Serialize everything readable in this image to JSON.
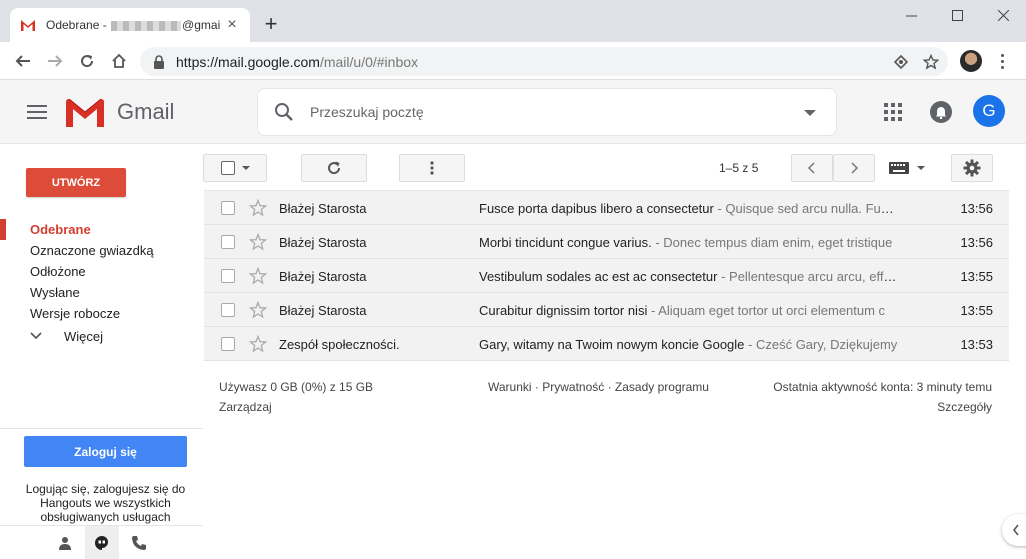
{
  "browser": {
    "tab_title_prefix": "Odebrane - ",
    "tab_title_suffix": "@gmai",
    "url_host": "https://mail.google.com",
    "url_path": "/mail/u/0/#inbox"
  },
  "gmail": {
    "brand": "Gmail",
    "search_placeholder": "Przeszukaj pocztę",
    "avatar_letter": "G",
    "accent": "#dd4b39",
    "blue": "#4285f4"
  },
  "sidebar": {
    "compose_label": "UTWÓRZ",
    "items": [
      {
        "label": "Odebrane",
        "active": true
      },
      {
        "label": "Oznaczone gwiazdką"
      },
      {
        "label": "Odłożone"
      },
      {
        "label": "Wysłane"
      },
      {
        "label": "Wersje robocze"
      }
    ],
    "more_label": "Więcej",
    "login_label": "Zaloguj się",
    "hangouts_text": "Logując się, zalogujesz się do Hangouts we wszystkich obsługiwanych usługach"
  },
  "toolbar": {
    "pager_text": "1–5 z 5"
  },
  "mails": [
    {
      "sender": "Błażej Starosta",
      "subject": "Fusce porta dapibus libero a consectetur",
      "snippet": " - Quisque sed arcu nulla. Fusce",
      "time": "13:56"
    },
    {
      "sender": "Błażej Starosta",
      "subject": "Morbi tincidunt congue varius.",
      "snippet": " - Donec tempus diam enim, eget tristique",
      "time": "13:56"
    },
    {
      "sender": "Błażej Starosta",
      "subject": "Vestibulum sodales ac est ac consectetur",
      "snippet": " - Pellentesque arcu arcu, efficitur",
      "time": "13:55"
    },
    {
      "sender": "Błażej Starosta",
      "subject": "Curabitur dignissim tortor nisi",
      "snippet": " - Aliquam eget tortor ut orci elementum c",
      "time": "13:55"
    },
    {
      "sender": "Zespół społeczności.",
      "subject": "Gary, witamy na Twoim nowym koncie Google",
      "snippet": " - Cześć Gary, Dziękujemy",
      "time": "13:53"
    }
  ],
  "footer": {
    "storage": "Używasz 0 GB (0%) z 15 GB",
    "manage": "Zarządzaj",
    "links": "Warunki · Prywatność · Zasady programu",
    "activity": "Ostatnia aktywność konta: 3 minuty temu",
    "details": "Szczegóły"
  }
}
